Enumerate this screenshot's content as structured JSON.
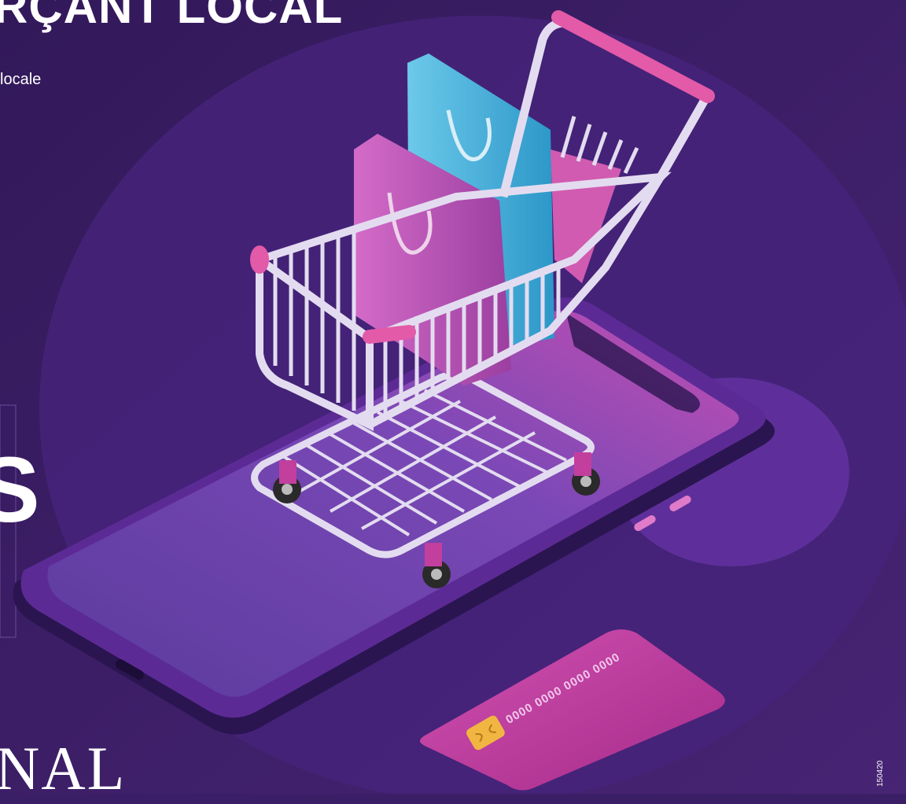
{
  "headline": "RÇANT LOCAL",
  "subline": "locale",
  "big_letter": "S",
  "brand": "NAL",
  "card_number": "0000 0000 0000 0000",
  "ref_code": "150420",
  "colors": {
    "background": "#3b1f66",
    "circle": "#45237a",
    "phone_body": "#5c2a95",
    "phone_screen": "#6e45b5",
    "cart_frame": "#e3dcf0",
    "bag_blue": "#3fb1dc",
    "bag_pink": "#c25bb8",
    "cart_accent": "#e35aa8",
    "credit_card": "#c23f9d",
    "chip": "#f1b541"
  },
  "illustration": [
    "shopping-cart-icon",
    "shopping-bag-icon",
    "smartphone-icon",
    "credit-card-icon"
  ]
}
